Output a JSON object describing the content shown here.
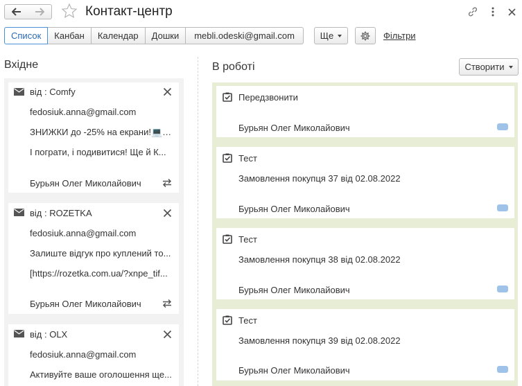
{
  "window": {
    "title": "Контакт-центр"
  },
  "toolbar": {
    "tabs": [
      "Список",
      "Канбан",
      "Календар",
      "Дошки",
      "mebli.odeski@gmail.com"
    ],
    "active_tab": "Список",
    "more_label": "Ще",
    "filters_label": "Фільтри"
  },
  "incoming": {
    "title": "Вхідне",
    "cards": [
      {
        "from": "від : Comfy",
        "email": "fedosiuk.anna@gmail.com",
        "line1": "ЗНИЖКИ до -25% на екрани!💻🖥",
        "line2": " І пограти, і подивитися! Ще й К...",
        "assignee": "Бурьян Олег Миколайович"
      },
      {
        "from": "від : ROZETKA",
        "email": "fedosiuk.anna@gmail.com",
        "line1": "Залиште відгук про куплений то...",
        "line2": "[https://rozetka.com.ua/?xnpe_tif...",
        "assignee": "Бурьян Олег Миколайович"
      },
      {
        "from": "від : OLX",
        "email": "fedosiuk.anna@gmail.com",
        "line1": "Активуйте ваше оголошення ще..."
      }
    ]
  },
  "in_work": {
    "title": "В роботі",
    "create_label": "Створити",
    "cards": [
      {
        "title": "Передзвонити",
        "subtitle": "",
        "assignee": "Бурьян Олег Миколайович"
      },
      {
        "title": "Тест",
        "subtitle": "Замовлення покупця 37 від 02.08.2022",
        "assignee": "Бурьян Олег Миколайович"
      },
      {
        "title": "Тест",
        "subtitle": "Замовлення покупця 38 від 02.08.2022",
        "assignee": "Бурьян Олег Миколайович"
      },
      {
        "title": "Тест",
        "subtitle": "Замовлення покупця 39 від 02.08.2022",
        "assignee": "Бурьян Олег Миколайович"
      }
    ]
  },
  "icons": {
    "back": "arrow-left-icon",
    "forward": "arrow-right-icon",
    "favorite": "star-icon",
    "link": "link-icon",
    "menu": "more-vertical-icon",
    "close": "close-icon",
    "settings": "gear-icon",
    "mail": "envelope-icon",
    "task": "checkbox-icon",
    "transfer": "swap-arrows-icon"
  },
  "colors": {
    "active_tab": "#2a6bb3",
    "in_work_bg": "#e8edd6",
    "tag": "#9fc3e8"
  }
}
